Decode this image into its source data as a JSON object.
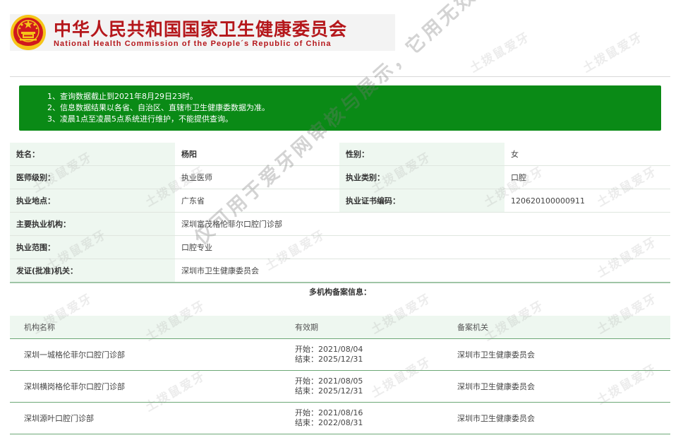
{
  "header": {
    "title_cn": "中华人民共和国国家卫生健康委员会",
    "title_en": "National Health Commission of the People´s Republic of China",
    "emblem_icon": "national-emblem-icon",
    "colors": {
      "brand_red": "#b5171b",
      "emblem_gold": "#f5c518"
    }
  },
  "notice": {
    "background": "#0a8a16",
    "lines": [
      "1、查询数据截止到2021年8月29日23时。",
      "2、信息数据结果以各省、自治区、直辖市卫生健康委数据为准。",
      "3、凌晨1点至凌晨5点系统进行维护，不能提供查询。"
    ]
  },
  "info": {
    "name_label": "姓名：",
    "name_value": "杨阳",
    "gender_label": "性别：",
    "gender_value": "女",
    "level_label": "医师级别：",
    "level_value": "执业医师",
    "category_label": "执业类别：",
    "category_value": "口腔",
    "location_label": "执业地点：",
    "location_value": "广东省",
    "cert_label": "执业证书编码：",
    "cert_value": "120620100000911",
    "org_label": "主要执业机构：",
    "org_value": "深圳富茂格伦菲尔口腔门诊部",
    "scope_label": "执业范围：",
    "scope_value": "口腔专业",
    "issuer_label": "发证(批准)机关：",
    "issuer_value": "深圳市卫生健康委员会"
  },
  "multi": {
    "title": "多机构备案信息：",
    "columns": [
      "机构名称",
      "有效期",
      "备案机关"
    ],
    "rows": [
      {
        "org": "深圳一城格伦菲尔口腔门诊部",
        "start": "开始：2021/08/04",
        "end": "结束：2025/12/31",
        "authority": "深圳市卫生健康委员会"
      },
      {
        "org": "深圳横岗格伦菲尔口腔门诊部",
        "start": "开始：2021/08/05",
        "end": "结束：2025/12/31",
        "authority": "深圳市卫生健康委员会"
      },
      {
        "org": "深圳源叶口腔门诊部",
        "start": "开始：2021/08/16",
        "end": "结束：2022/08/31",
        "authority": "深圳市卫生健康委员会"
      }
    ]
  },
  "watermark": {
    "small_text": "土拨鼠爱牙",
    "big_text": "仅可用于爱牙网审核与展示，它用无效"
  }
}
